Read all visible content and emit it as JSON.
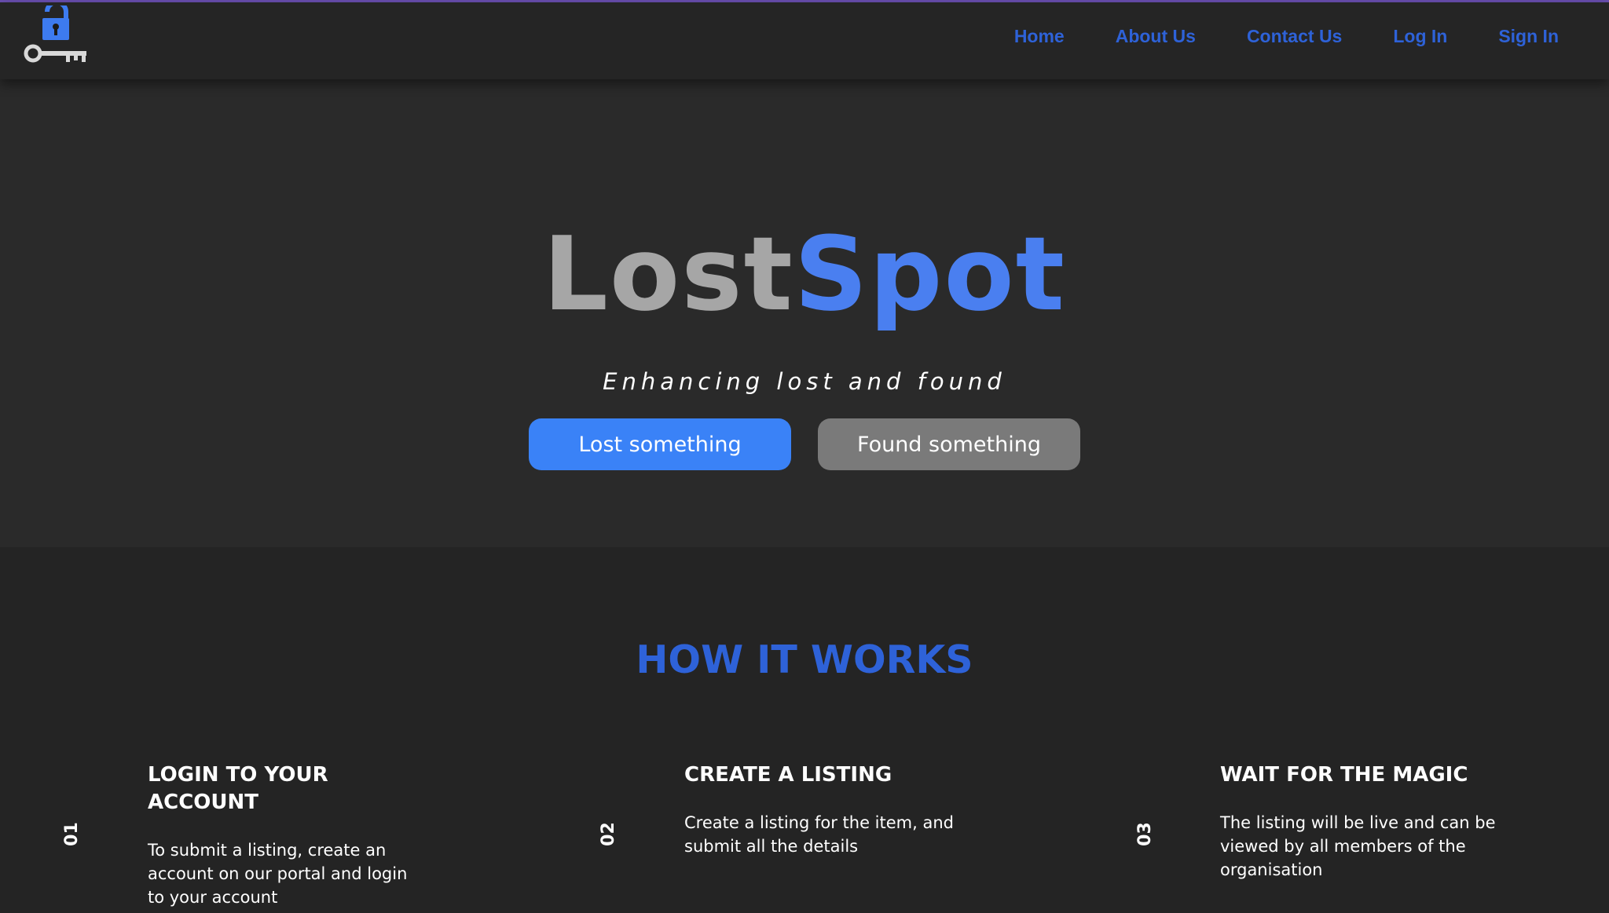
{
  "nav": {
    "logo_icon": "lock-and-key-icon",
    "links": [
      "Home",
      "About Us",
      "Contact Us",
      "Log In",
      "Sign In"
    ]
  },
  "hero": {
    "brand_part1": "Lost",
    "brand_part2": "Spot",
    "tagline": "Enhancing lost and found",
    "lost_button": "Lost something",
    "found_button": "Found something"
  },
  "how_it_works": {
    "title": "HOW IT WORKS",
    "steps": [
      {
        "number": "01",
        "title_line1": "LOGIN TO YOUR",
        "title_line2": "ACCOUNT",
        "text_line1": "To submit a listing, create an",
        "text_line2": "account on our portal and login",
        "text_line3": "to your account"
      },
      {
        "number": "02",
        "title_line1": "CREATE A LISTING",
        "title_line2": "",
        "text_line1": "Create a listing for the item, and",
        "text_line2": "submit all the details",
        "text_line3": ""
      },
      {
        "number": "03",
        "title_line1": "WAIT FOR THE MAGIC",
        "title_line2": "",
        "text_line1": "The listing will be live and can be",
        "text_line2": "viewed by all members of the",
        "text_line3": "organisation"
      }
    ]
  },
  "colors": {
    "accent": "#2e62d8",
    "brand_blue": "#4a7ff0",
    "lost_button": "#3a82f7",
    "found_button": "#7a7a7a",
    "hero_bg": "#2a2a2a",
    "page_bg": "#242424"
  }
}
